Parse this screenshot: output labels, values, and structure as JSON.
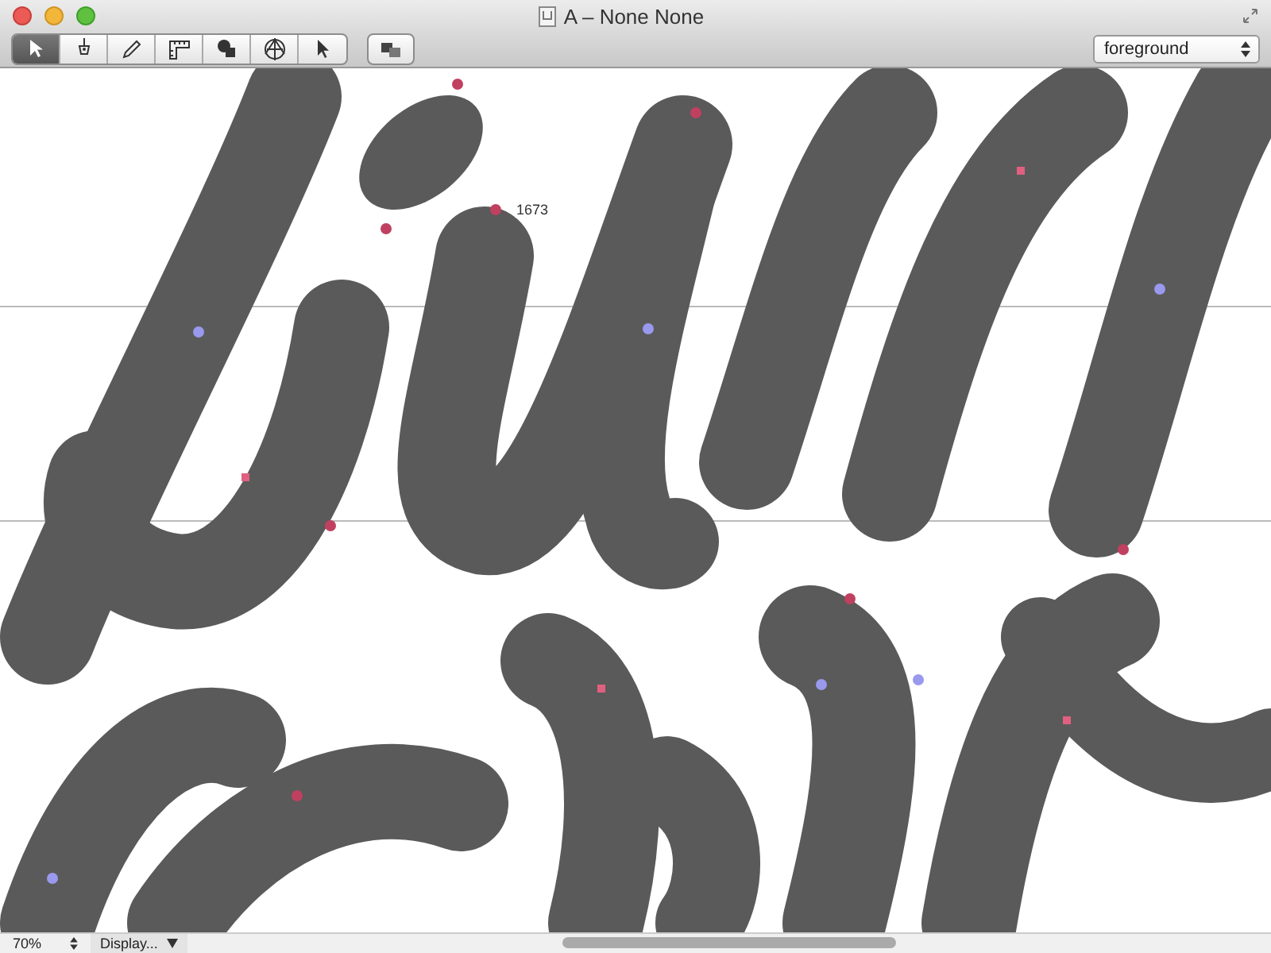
{
  "window": {
    "title": "A – None None"
  },
  "toolbar": {
    "tools": [
      {
        "kind": "pointer",
        "selected": true
      },
      {
        "kind": "pen",
        "selected": false
      },
      {
        "kind": "pencil",
        "selected": false
      },
      {
        "kind": "ruler",
        "selected": false
      },
      {
        "kind": "shapes",
        "selected": false
      },
      {
        "kind": "target",
        "selected": false
      },
      {
        "kind": "arrow",
        "selected": false
      }
    ],
    "layer_menu": {
      "value": "foreground"
    }
  },
  "canvas": {
    "node_label": "1673"
  },
  "status_bar": {
    "zoom": "70%",
    "display_menu": "Display..."
  }
}
